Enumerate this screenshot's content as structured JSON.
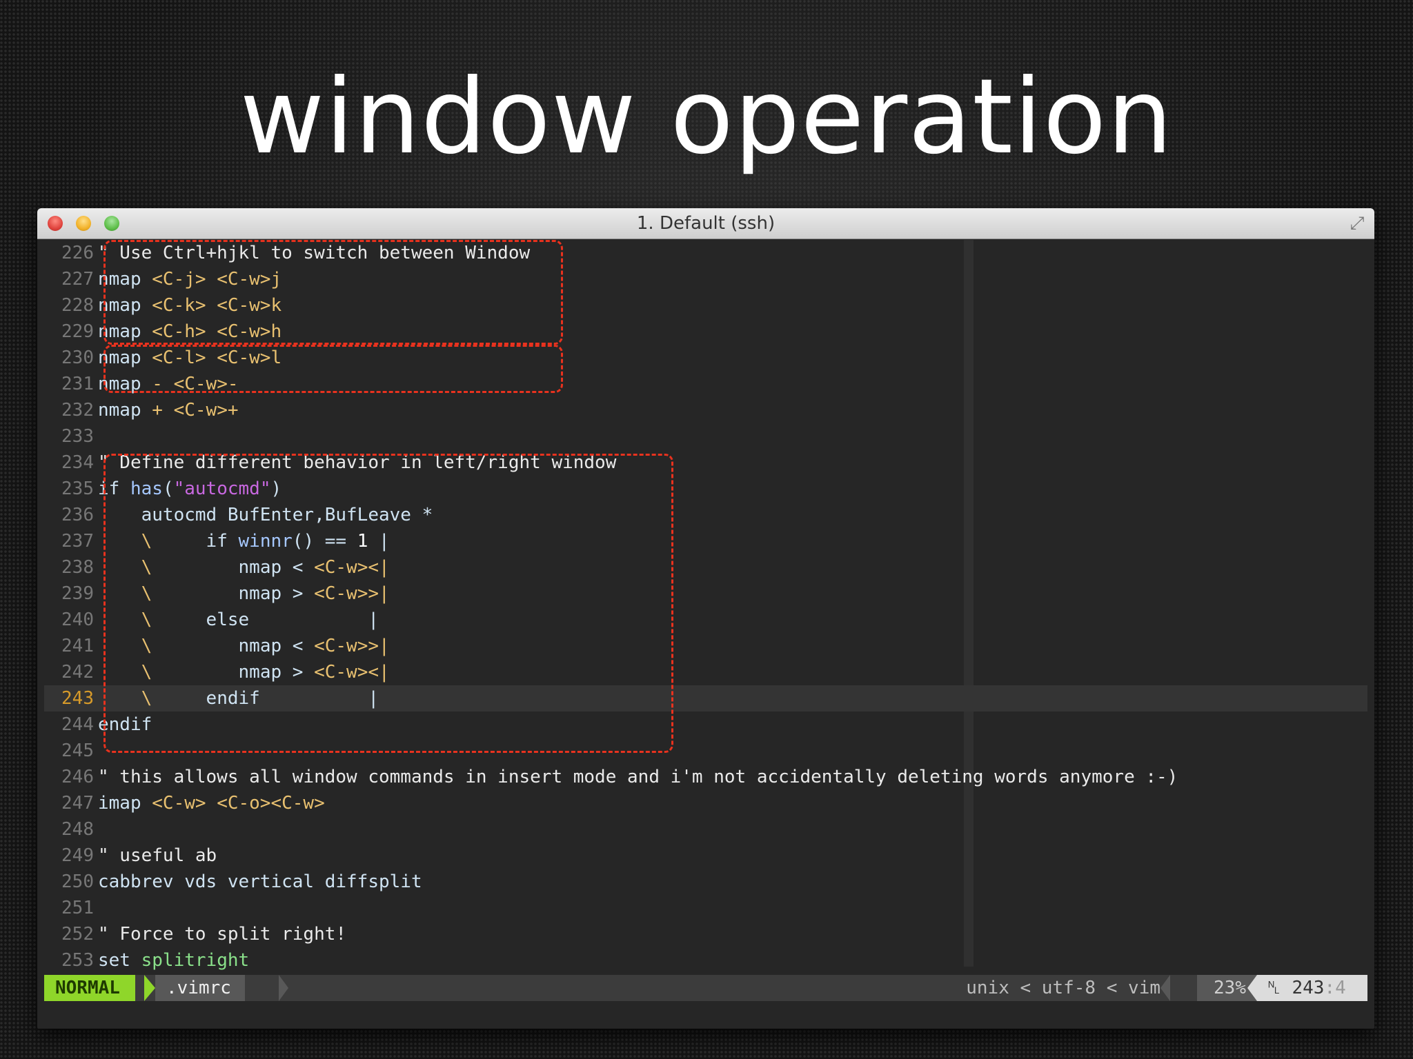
{
  "slide": {
    "title": "window operation"
  },
  "window": {
    "title": "1. Default (ssh)",
    "fullscreen_glyph": "⤢"
  },
  "editor": {
    "lines": [
      {
        "num": "226",
        "parts": [
          {
            "t": "\" Use Ctrl+hjkl to switch between Window",
            "c": "comment"
          }
        ]
      },
      {
        "num": "227",
        "parts": [
          {
            "t": "nmap",
            "c": "keyword"
          },
          {
            "t": " <C-j> <C-w>j",
            "c": "special"
          }
        ]
      },
      {
        "num": "228",
        "parts": [
          {
            "t": "nmap",
            "c": "keyword"
          },
          {
            "t": " <C-k> <C-w>k",
            "c": "special"
          }
        ]
      },
      {
        "num": "229",
        "parts": [
          {
            "t": "nmap",
            "c": "keyword"
          },
          {
            "t": " <C-h> <C-w>h",
            "c": "special"
          }
        ]
      },
      {
        "num": "230",
        "parts": [
          {
            "t": "nmap",
            "c": "keyword"
          },
          {
            "t": " <C-l> <C-w>l",
            "c": "special"
          }
        ]
      },
      {
        "num": "231",
        "parts": [
          {
            "t": "nmap",
            "c": "keyword"
          },
          {
            "t": " - <C-w>-",
            "c": "special"
          }
        ]
      },
      {
        "num": "232",
        "parts": [
          {
            "t": "nmap",
            "c": "keyword"
          },
          {
            "t": " + <C-w>+",
            "c": "special"
          }
        ]
      },
      {
        "num": "233",
        "parts": []
      },
      {
        "num": "234",
        "parts": [
          {
            "t": "\" Define different behavior in left/right window",
            "c": "comment"
          }
        ]
      },
      {
        "num": "235",
        "parts": [
          {
            "t": "if ",
            "c": "keyword"
          },
          {
            "t": "has",
            "c": "func"
          },
          {
            "t": "(",
            "c": "keyword"
          },
          {
            "t": "\"autocmd\"",
            "c": "string"
          },
          {
            "t": ")",
            "c": "keyword"
          }
        ]
      },
      {
        "num": "236",
        "parts": [
          {
            "t": "    autocmd BufEnter,BufLeave *",
            "c": "keyword"
          }
        ]
      },
      {
        "num": "237",
        "parts": [
          {
            "t": "    \\",
            "c": "special"
          },
          {
            "t": "     if ",
            "c": "keyword"
          },
          {
            "t": "winnr",
            "c": "func"
          },
          {
            "t": "() == ",
            "c": "keyword"
          },
          {
            "t": "1",
            "c": "number"
          },
          {
            "t": " |",
            "c": "keyword"
          }
        ]
      },
      {
        "num": "238",
        "parts": [
          {
            "t": "    \\",
            "c": "special"
          },
          {
            "t": "        nmap < ",
            "c": "keyword"
          },
          {
            "t": "<C-w><|",
            "c": "special"
          }
        ]
      },
      {
        "num": "239",
        "parts": [
          {
            "t": "    \\",
            "c": "special"
          },
          {
            "t": "        nmap > ",
            "c": "keyword"
          },
          {
            "t": "<C-w>>|",
            "c": "special"
          }
        ]
      },
      {
        "num": "240",
        "parts": [
          {
            "t": "    \\",
            "c": "special"
          },
          {
            "t": "     else           |",
            "c": "keyword"
          }
        ]
      },
      {
        "num": "241",
        "parts": [
          {
            "t": "    \\",
            "c": "special"
          },
          {
            "t": "        nmap < ",
            "c": "keyword"
          },
          {
            "t": "<C-w>>|",
            "c": "special"
          }
        ]
      },
      {
        "num": "242",
        "parts": [
          {
            "t": "    \\",
            "c": "special"
          },
          {
            "t": "        nmap > ",
            "c": "keyword"
          },
          {
            "t": "<C-w><|",
            "c": "special"
          }
        ]
      },
      {
        "num": "243",
        "parts": [
          {
            "t": "    \\",
            "c": "special"
          },
          {
            "t": "     endif          |",
            "c": "keyword"
          }
        ],
        "current": true
      },
      {
        "num": "244",
        "parts": [
          {
            "t": "endif",
            "c": "keyword"
          }
        ]
      },
      {
        "num": "245",
        "parts": []
      },
      {
        "num": "246",
        "parts": [
          {
            "t": "\" this allows all window commands in insert mode and i'm not accidentally deleting words anymore :-)",
            "c": "comment"
          }
        ]
      },
      {
        "num": "247",
        "parts": [
          {
            "t": "imap",
            "c": "keyword"
          },
          {
            "t": " <C-w> <C-o><C-w>",
            "c": "special"
          }
        ]
      },
      {
        "num": "248",
        "parts": []
      },
      {
        "num": "249",
        "parts": [
          {
            "t": "\" useful ab",
            "c": "comment"
          }
        ]
      },
      {
        "num": "250",
        "parts": [
          {
            "t": "cabbrev vds vertical diffsplit",
            "c": "keyword"
          }
        ]
      },
      {
        "num": "251",
        "parts": []
      },
      {
        "num": "252",
        "parts": [
          {
            "t": "\" Force to split right!",
            "c": "comment"
          }
        ]
      },
      {
        "num": "253",
        "parts": [
          {
            "t": "set ",
            "c": "keyword"
          },
          {
            "t": "splitright",
            "c": "option"
          }
        ]
      }
    ]
  },
  "statusline": {
    "mode": "NORMAL",
    "file": ".vimrc",
    "encoding": "unix < utf-8 < vim",
    "percent": "23%",
    "position_icon": "␤",
    "line": "243",
    "col": ":4"
  }
}
